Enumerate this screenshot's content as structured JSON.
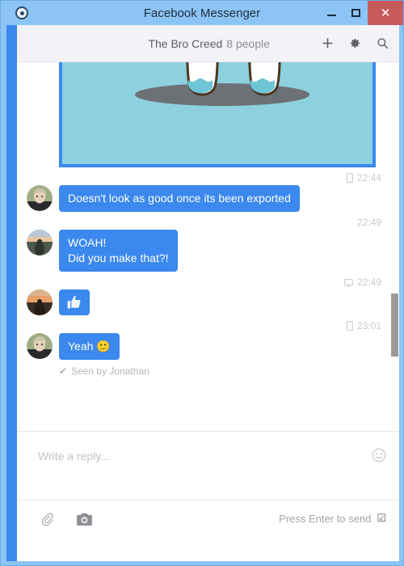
{
  "window": {
    "title": "Facebook Messenger",
    "app_icon": "messenger-circle-icon",
    "controls": {
      "minimize": "minimize-icon",
      "maximize": "maximize-icon",
      "close": "✕"
    }
  },
  "conversation_header": {
    "thread_name": "The Bro Creed",
    "people_count": "8 people",
    "actions": [
      {
        "name": "add-people-button",
        "icon": "plus-icon"
      },
      {
        "name": "settings-button",
        "icon": "gear-icon"
      },
      {
        "name": "search-button",
        "icon": "search-icon"
      }
    ]
  },
  "attachment": {
    "name": "photo-attachment",
    "background_color": "#8ed0de",
    "frame_color": "#3b88ee",
    "shadow_color": "#6b7175",
    "outline_color": "#4a3520",
    "fill_color": "#ffffff",
    "water_color": "#6ec5d5"
  },
  "messages": [
    {
      "id": "msg-1",
      "time": "22:44",
      "device_icon": "mobile-icon",
      "text": "Doesn't look as good once its been exported",
      "type": "text",
      "avatar": "avatar-green-portrait"
    },
    {
      "id": "msg-2",
      "time": "22:49",
      "device_icon": "",
      "text": "WOAH!",
      "text_line2": "Did you make that?!",
      "type": "text",
      "avatar": "avatar-sunset-silhouette"
    },
    {
      "id": "msg-3",
      "time": "22:49",
      "device_icon": "desktop-icon",
      "text": "",
      "type": "sticker",
      "sticker": "thumbs-up-icon",
      "avatar": "avatar-sunset-silhouette"
    },
    {
      "id": "msg-4",
      "time": "23:01",
      "device_icon": "mobile-icon",
      "text": "Yeah 🙂",
      "type": "text",
      "avatar": "avatar-green-portrait"
    }
  ],
  "seen_status": {
    "check": "✔",
    "text": "Seen by Jonathan"
  },
  "composer": {
    "placeholder": "Write a reply...",
    "value": "",
    "emoji_button": "smiley-icon"
  },
  "toolbar": {
    "attach_icon": "paperclip-icon",
    "camera_icon": "camera-icon",
    "send_hint": "Press Enter to send",
    "send_checkbox": "☑",
    "send_checkbox_checked": true
  },
  "colors": {
    "accent_blue": "#3b88ee",
    "window_chrome": "#8cc4f5",
    "close_red": "#c75b5b",
    "header_bg": "#f3f3f7",
    "timestamp_gray": "#c9c9d0"
  }
}
